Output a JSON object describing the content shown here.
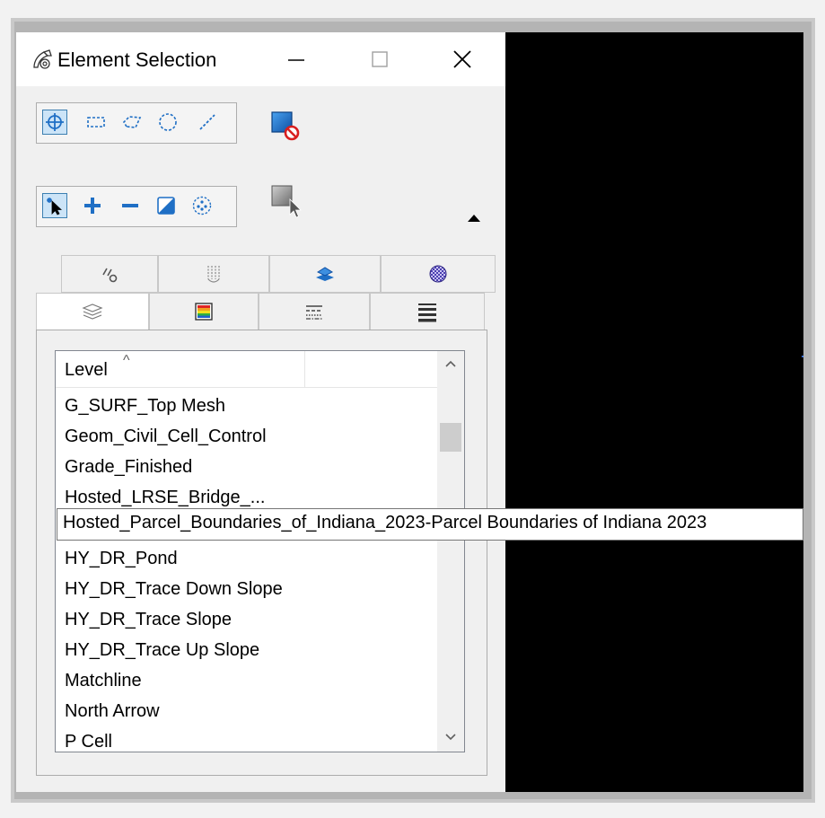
{
  "window": {
    "title": "Element Selection",
    "controls": {
      "minimize": "—",
      "maximize": "☐",
      "close": "✕"
    }
  },
  "toolbar1": {
    "icons": [
      "individual-select-icon",
      "block-select-icon",
      "shape-select-icon",
      "circle-select-icon",
      "line-select-icon"
    ],
    "clear_icon": "clear-selection-icon"
  },
  "toolbar2": {
    "icons": [
      "new-select-icon",
      "add-icon",
      "subtract-icon",
      "invert-icon",
      "select-all-icon"
    ],
    "select_all_icon": "select-element-icon",
    "collapse_icon": "collapse-arrow-icon"
  },
  "tabs_row1": [
    "element-type-icon",
    "levels-icon",
    "display-icon",
    "material-icon"
  ],
  "tabs_row2": [
    "layers-icon",
    "color-icon",
    "line-style-icon",
    "line-weight-icon"
  ],
  "list": {
    "header": "Level",
    "sort_indicator": "^",
    "items": [
      "G_SURF_Top Mesh",
      "Geom_Civil_Cell_Control",
      "Grade_Finished",
      "Hosted_LRSE_Bridge_...",
      "",
      "HY_DR_Pond",
      "HY_DR_Trace Down Slope",
      "HY_DR_Trace Slope",
      "HY_DR_Trace Up Slope",
      "Matchline",
      "North Arrow",
      "P Cell"
    ]
  },
  "tooltip": "Hosted_Parcel_Boundaries_of_Indiana_2023-Parcel Boundaries of Indiana 2023"
}
